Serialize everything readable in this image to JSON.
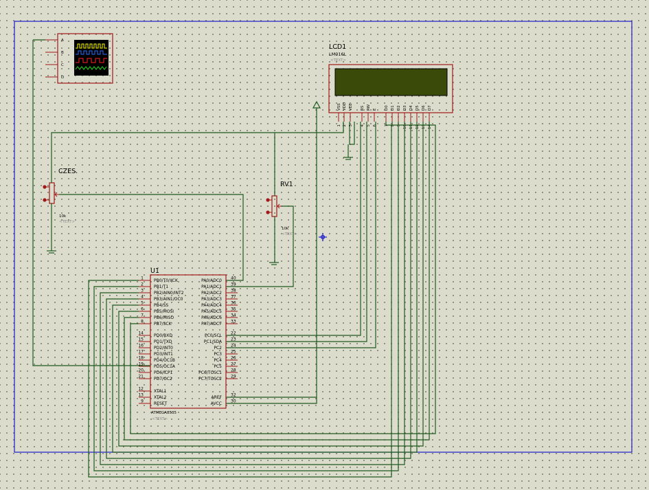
{
  "colors": {
    "background": "#dcdccc",
    "border": "#1c1ccc",
    "wire": "#1e5a1e",
    "component_body": "#a01818",
    "lcd_screen": "#3a4a08"
  },
  "scope": {
    "channels": [
      "A",
      "B",
      "C",
      "D"
    ],
    "trace_colors": [
      "#ffff00",
      "#2a6cff",
      "#ff2222",
      "#22dd22"
    ]
  },
  "lcd": {
    "ref": "LCD1",
    "part": "LM016L",
    "text_tag": "<TEXT>",
    "pin_names": [
      "VSS",
      "VDD",
      "VEE",
      "RS",
      "RW",
      "E",
      "D0",
      "D1",
      "D2",
      "D3",
      "D4",
      "D5",
      "D6",
      "D7"
    ],
    "pin_numbers": [
      "1",
      "2",
      "3",
      "4",
      "5",
      "6",
      "7",
      "8",
      "9",
      "10",
      "11",
      "12",
      "13",
      "14"
    ]
  },
  "pot_czes": {
    "ref": "CZES.",
    "value": "10k",
    "text_tag": "<TEXT>"
  },
  "pot_rv1": {
    "ref": "RV1",
    "value": "10k",
    "text_tag": "<TEXT>"
  },
  "mcu": {
    "ref": "U1",
    "part": "ATMEGA8535",
    "text_tag": "<TEXT>",
    "left_pins": [
      {
        "num": "1",
        "name": "PB0/T0/XCK"
      },
      {
        "num": "2",
        "name": "PB1/T1"
      },
      {
        "num": "3",
        "name": "PB2/AIN0/INT2"
      },
      {
        "num": "4",
        "name": "PB3/AIN1/OC0"
      },
      {
        "num": "5",
        "name": "PB4/SS"
      },
      {
        "num": "6",
        "name": "PB5/MOSI"
      },
      {
        "num": "7",
        "name": "PB6/MISO"
      },
      {
        "num": "8",
        "name": "PB7/SCK"
      },
      {
        "num": "14",
        "name": "PD0/RXD"
      },
      {
        "num": "15",
        "name": "PD1/TXD"
      },
      {
        "num": "16",
        "name": "PD2/INT0"
      },
      {
        "num": "17",
        "name": "PD3/INT1"
      },
      {
        "num": "18",
        "name": "PD4/OC1B"
      },
      {
        "num": "19",
        "name": "PD5/OC1A"
      },
      {
        "num": "20",
        "name": "PD6/ICP1"
      },
      {
        "num": "21",
        "name": "PD7/OC2"
      },
      {
        "num": "12",
        "name": "XTAL1"
      },
      {
        "num": "13",
        "name": "XTAL2"
      },
      {
        "num": "9",
        "name": "RESET"
      }
    ],
    "right_pins": [
      {
        "num": "40",
        "name": "PA0/ADC0"
      },
      {
        "num": "39",
        "name": "PA1/ADC1"
      },
      {
        "num": "38",
        "name": "PA2/ADC2"
      },
      {
        "num": "37",
        "name": "PA3/ADC3"
      },
      {
        "num": "36",
        "name": "PA4/ADC4"
      },
      {
        "num": "35",
        "name": "PA5/ADC5"
      },
      {
        "num": "34",
        "name": "PA6/ADC6"
      },
      {
        "num": "33",
        "name": "PA7/ADC7"
      },
      {
        "num": "22",
        "name": "PC0/SCL"
      },
      {
        "num": "23",
        "name": "PC1/SDA"
      },
      {
        "num": "24",
        "name": "PC2"
      },
      {
        "num": "25",
        "name": "PC3"
      },
      {
        "num": "26",
        "name": "PC4"
      },
      {
        "num": "27",
        "name": "PC5"
      },
      {
        "num": "28",
        "name": "PC6/TOSC1"
      },
      {
        "num": "29",
        "name": "PC7/TOSC2"
      },
      {
        "num": "32",
        "name": "AREF"
      },
      {
        "num": "30",
        "name": "AVCC"
      }
    ]
  }
}
